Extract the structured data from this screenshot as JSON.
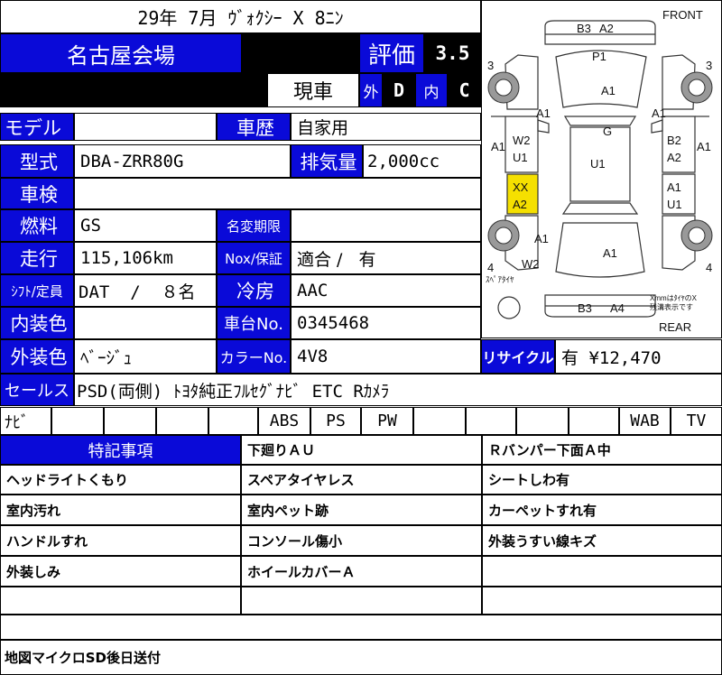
{
  "header": {
    "title": "29年 7月 ｳﾞｫｸｼｰ X 8ﾆﾝ",
    "venue": "名古屋会場",
    "rating_label": "評価",
    "rating_value": "3.5",
    "genkuruma": "現車",
    "exterior_label": "外",
    "exterior_grade": "D",
    "interior_label": "内",
    "interior_grade": "C"
  },
  "specs": {
    "model_label": "モデル",
    "model_value": "",
    "history_label": "車歴",
    "history_value": "自家用",
    "type_label": "型式",
    "type_value": "DBA-ZRR80G",
    "displacement_label": "排気量",
    "displacement_value": "2,000cc",
    "inspection_label": "車検",
    "inspection_value": "",
    "fuel_label": "燃料",
    "fuel_value": "GS",
    "name_change_label": "名変期限",
    "name_change_value": "",
    "mileage_label": "走行",
    "mileage_value": "115,106km",
    "nox_label": "Nox/保証",
    "nox_value": "適合 /   有",
    "shift_label": "ｼﾌﾄ/定員",
    "shift_value": "DAT  /  ８名",
    "ac_label": "冷房",
    "ac_value": "AAC",
    "interior_color_label": "内装色",
    "interior_color_value": "",
    "chassis_label": "車台No.",
    "chassis_value": "0345468",
    "exterior_color_label": "外装色",
    "exterior_color_value": "ﾍﾞｰｼﾞｭ",
    "color_no_label": "カラーNo.",
    "color_no_value": "4V8",
    "recycle_label": "リサイクル",
    "recycle_value": "有 ¥12,470",
    "sales_label": "セールス",
    "sales_value": "PSD(両側) ﾄﾖﾀ純正ﾌﾙｾｸﾞﾅﾋﾞ ETC Rｶﾒﾗ"
  },
  "equipment": [
    "ﾅﾋﾞ",
    "",
    "",
    "",
    "",
    "ABS",
    "PS",
    "PW",
    "",
    "",
    "",
    "WAB",
    "TV"
  ],
  "notes": {
    "header": "特記事項",
    "rows": [
      [
        "",
        "下廻りＡＵ",
        "Ｒバンパー下面Ａ中"
      ],
      [
        "ヘッドライトくもり",
        "スペアタイヤレス",
        "シートしわ有"
      ],
      [
        "室内汚れ",
        "室内ペット跡",
        "カーペットすれ有"
      ],
      [
        "ハンドルすれ",
        "コンソール傷小",
        "外装うすい線キズ"
      ],
      [
        "外装しみ",
        "ホイールカバーＡ",
        ""
      ],
      [
        "",
        "",
        ""
      ]
    ],
    "footer": "地図マイクロSD後日送付"
  },
  "diagram": {
    "front": "FRONT",
    "rear": "REAR",
    "spare": "ｽﾍﾟｱﾀｲﾔ",
    "note_line1": "XmmはﾀｲﾔのX",
    "note_line2": "残溝表示です",
    "highlight_color": "#f5e000",
    "marks": {
      "b3_front": "B3",
      "a2_front": "A2",
      "p1": "P1",
      "tire_fl": "3",
      "tire_fr": "3",
      "tire_rl": "4",
      "tire_rr": "4",
      "hood": "A1",
      "fender_l": "A1",
      "fender_r": "A1",
      "g": "G",
      "u1_center": "U1",
      "l_side_front": "A1",
      "r_side_front": "A1",
      "w2_l": "W2",
      "u1_l": "U1",
      "b2_r": "B2",
      "a2_r": "A2",
      "xx": "XX",
      "a2_l": "A2",
      "a1_r": "A1",
      "u1_r": "U1",
      "a1_rear_l": "A1",
      "w2_rear": "W2",
      "a1_rear_c": "A1",
      "b3_rear": "B3",
      "a4_rear": "A4"
    }
  }
}
